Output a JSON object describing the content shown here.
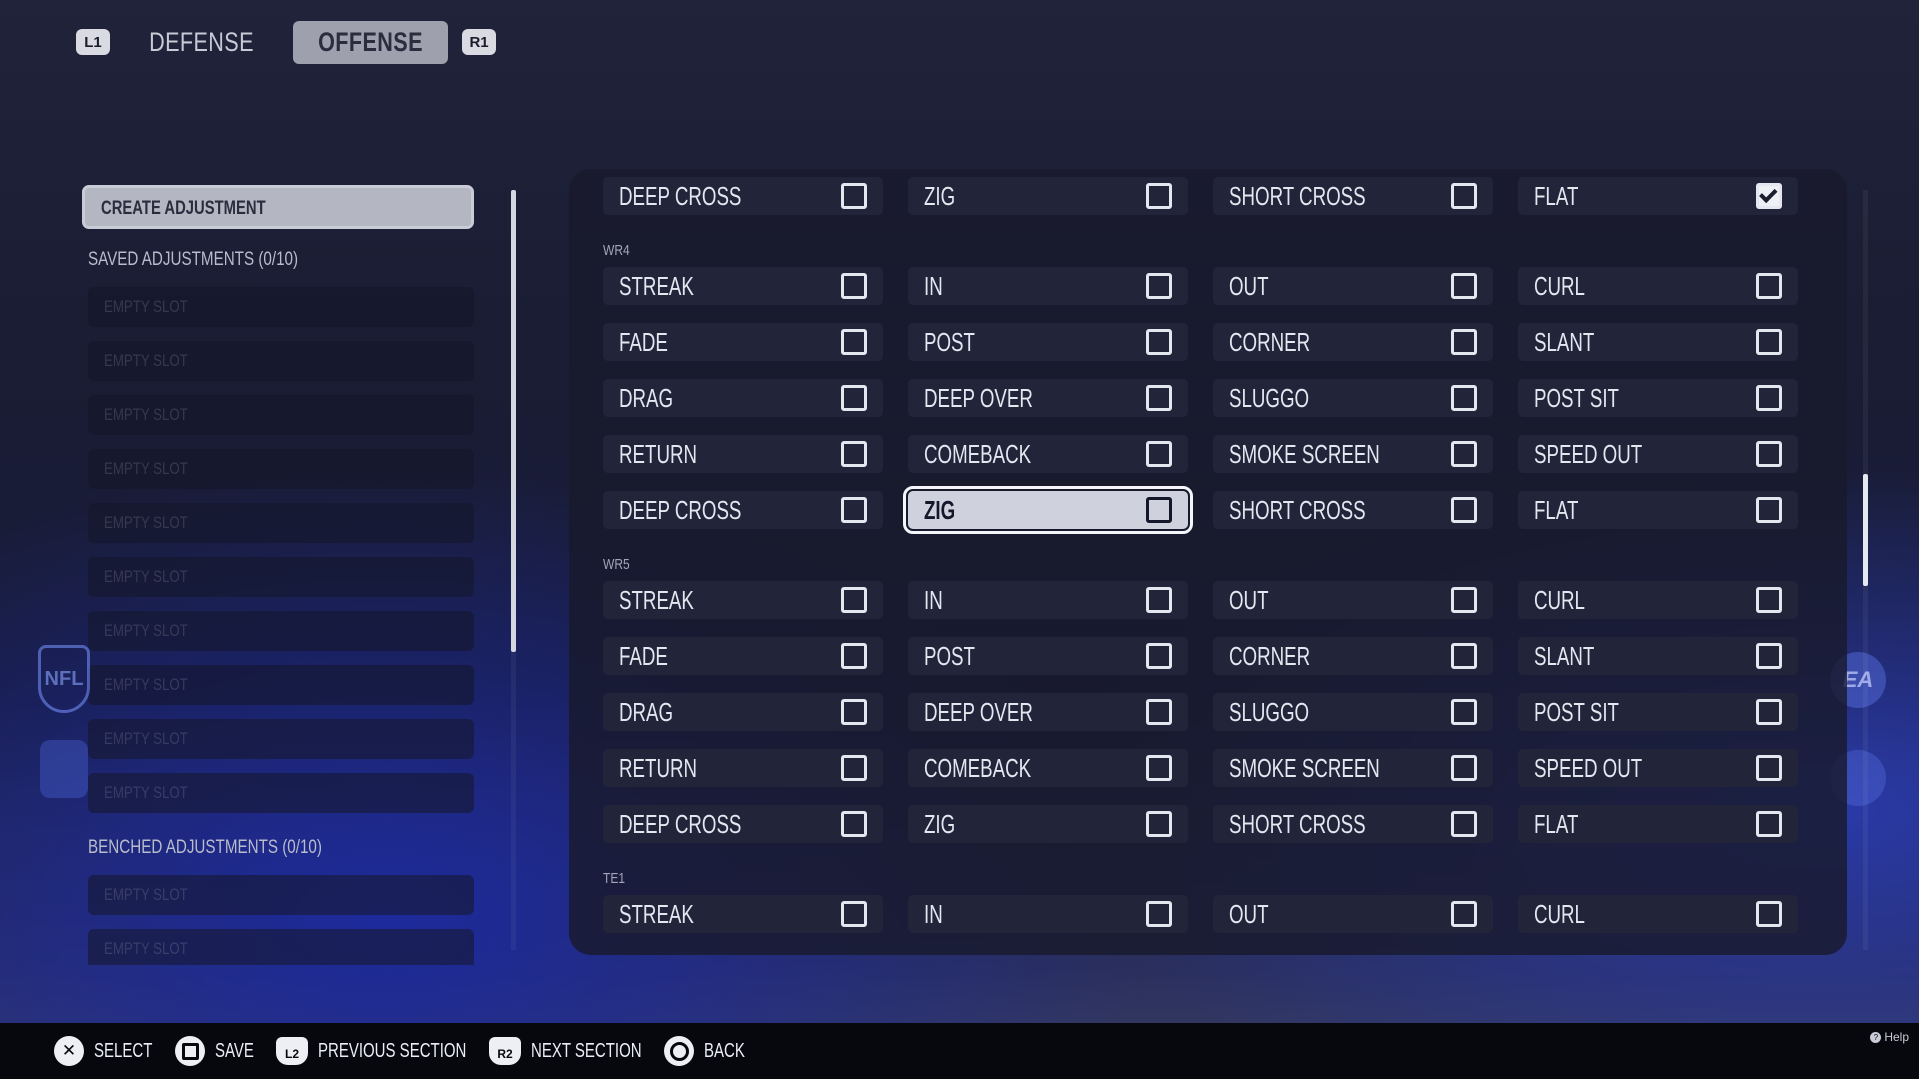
{
  "top_tabs": {
    "left_shoulder": "L1",
    "right_shoulder": "R1",
    "tabs": [
      {
        "label": "DEFENSE",
        "active": false
      },
      {
        "label": "OFFENSE",
        "active": true
      }
    ]
  },
  "left_panel": {
    "create_button": "CREATE ADJUSTMENT",
    "saved_label": "SAVED ADJUSTMENTS (0/10)",
    "saved_slots": [
      "EMPTY SLOT",
      "EMPTY SLOT",
      "EMPTY SLOT",
      "EMPTY SLOT",
      "EMPTY SLOT",
      "EMPTY SLOT",
      "EMPTY SLOT",
      "EMPTY SLOT",
      "EMPTY SLOT",
      "EMPTY SLOT"
    ],
    "benched_label": "BENCHED ADJUSTMENTS (0/10)",
    "benched_slots": [
      "EMPTY SLOT",
      "EMPTY SLOT"
    ]
  },
  "grid": {
    "rows": [
      {
        "cells": [
          {
            "label": "DEEP CROSS",
            "checked": false
          },
          {
            "label": "ZIG",
            "checked": false
          },
          {
            "label": "SHORT CROSS",
            "checked": false
          },
          {
            "label": "FLAT",
            "checked": true
          }
        ]
      },
      {
        "group": "WR4"
      },
      {
        "cells": [
          {
            "label": "STREAK",
            "checked": false
          },
          {
            "label": "IN",
            "checked": false
          },
          {
            "label": "OUT",
            "checked": false
          },
          {
            "label": "CURL",
            "checked": false
          }
        ]
      },
      {
        "cells": [
          {
            "label": "FADE",
            "checked": false
          },
          {
            "label": "POST",
            "checked": false
          },
          {
            "label": "CORNER",
            "checked": false
          },
          {
            "label": "SLANT",
            "checked": false
          }
        ]
      },
      {
        "cells": [
          {
            "label": "DRAG",
            "checked": false
          },
          {
            "label": "DEEP OVER",
            "checked": false
          },
          {
            "label": "SLUGGO",
            "checked": false
          },
          {
            "label": "POST SIT",
            "checked": false
          }
        ]
      },
      {
        "cells": [
          {
            "label": "RETURN",
            "checked": false
          },
          {
            "label": "COMEBACK",
            "checked": false
          },
          {
            "label": "SMOKE SCREEN",
            "checked": false
          },
          {
            "label": "SPEED OUT",
            "checked": false
          }
        ]
      },
      {
        "cells": [
          {
            "label": "DEEP CROSS",
            "checked": false
          },
          {
            "label": "ZIG",
            "checked": false,
            "focused": true
          },
          {
            "label": "SHORT CROSS",
            "checked": false
          },
          {
            "label": "FLAT",
            "checked": false
          }
        ]
      },
      {
        "group": "WR5"
      },
      {
        "cells": [
          {
            "label": "STREAK",
            "checked": false
          },
          {
            "label": "IN",
            "checked": false
          },
          {
            "label": "OUT",
            "checked": false
          },
          {
            "label": "CURL",
            "checked": false
          }
        ]
      },
      {
        "cells": [
          {
            "label": "FADE",
            "checked": false
          },
          {
            "label": "POST",
            "checked": false
          },
          {
            "label": "CORNER",
            "checked": false
          },
          {
            "label": "SLANT",
            "checked": false
          }
        ]
      },
      {
        "cells": [
          {
            "label": "DRAG",
            "checked": false
          },
          {
            "label": "DEEP OVER",
            "checked": false
          },
          {
            "label": "SLUGGO",
            "checked": false
          },
          {
            "label": "POST SIT",
            "checked": false
          }
        ]
      },
      {
        "cells": [
          {
            "label": "RETURN",
            "checked": false
          },
          {
            "label": "COMEBACK",
            "checked": false
          },
          {
            "label": "SMOKE SCREEN",
            "checked": false
          },
          {
            "label": "SPEED OUT",
            "checked": false
          }
        ]
      },
      {
        "cells": [
          {
            "label": "DEEP CROSS",
            "checked": false
          },
          {
            "label": "ZIG",
            "checked": false
          },
          {
            "label": "SHORT CROSS",
            "checked": false
          },
          {
            "label": "FLAT",
            "checked": false
          }
        ]
      },
      {
        "group": "TE1"
      },
      {
        "cells": [
          {
            "label": "STREAK",
            "checked": false
          },
          {
            "label": "IN",
            "checked": false
          },
          {
            "label": "OUT",
            "checked": false
          },
          {
            "label": "CURL",
            "checked": false
          }
        ]
      }
    ]
  },
  "bottom_bar": {
    "hints": [
      {
        "icon": "cross-button-icon",
        "glyph": "✕",
        "label": "SELECT"
      },
      {
        "icon": "square-button-icon",
        "glyph": "",
        "label": "SAVE"
      },
      {
        "icon": "l2-trigger-icon",
        "glyph": "L2",
        "label": "PREVIOUS SECTION"
      },
      {
        "icon": "r2-trigger-icon",
        "glyph": "R2",
        "label": "NEXT SECTION"
      },
      {
        "icon": "circle-button-icon",
        "glyph": "",
        "label": "BACK"
      }
    ],
    "help": "Help"
  },
  "logos": {
    "nfl": "NFL",
    "ea": "EA"
  }
}
